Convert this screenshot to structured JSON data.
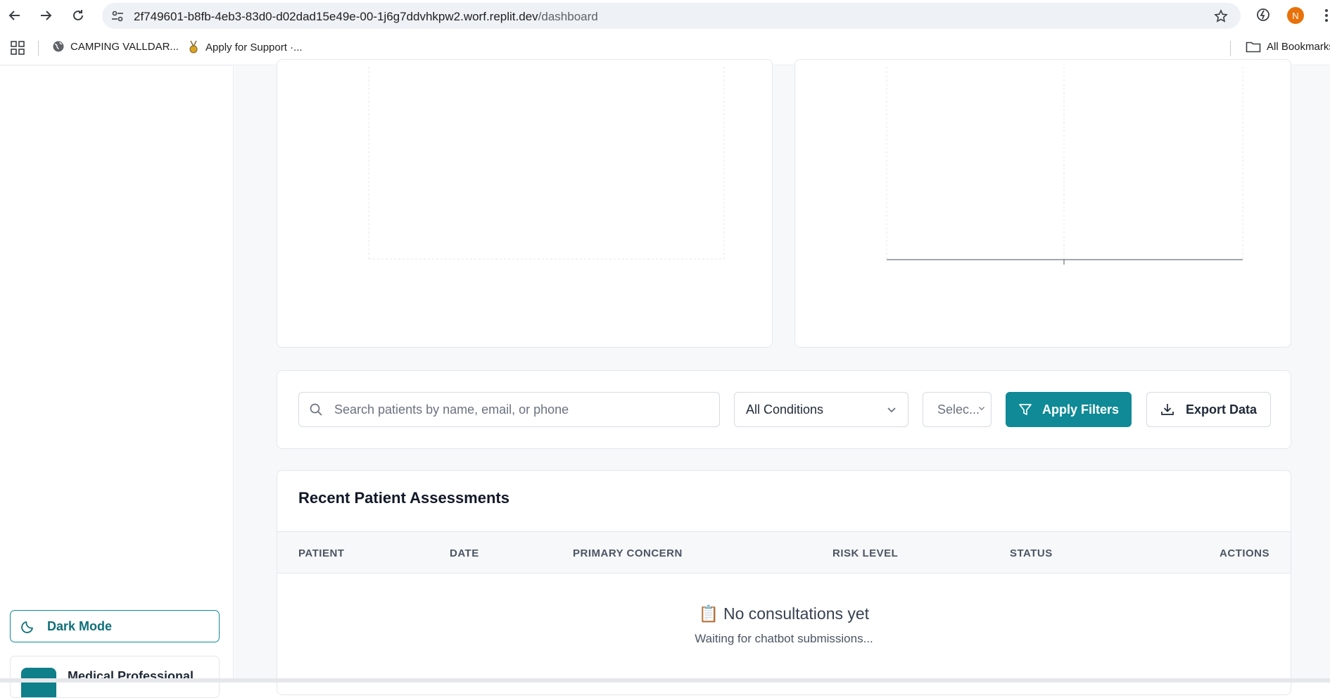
{
  "browser": {
    "url_host": "2f749601-b8fb-4eb3-83d0-d02dad15e49e-00-1j6g7ddvhkpw2.worf.replit.dev",
    "url_path": "/dashboard",
    "avatar_letter": "N",
    "bookmarks": [
      {
        "label": "CAMPING VALLDAR...",
        "icon": "globe-icon"
      },
      {
        "label": "Apply for Support  ·...",
        "icon": "award-icon"
      }
    ],
    "all_bookmarks_label": "All Bookmarks"
  },
  "sidebar": {
    "dark_mode_label": "Dark Mode",
    "profile_name": "Medical Professional"
  },
  "filters": {
    "search_placeholder": "Search patients by name, email, or phone",
    "condition_select": "All Conditions",
    "second_select": "Selec...",
    "apply_label": "Apply Filters",
    "export_label": "Export Data"
  },
  "table": {
    "title": "Recent Patient Assessments",
    "columns": [
      "PATIENT",
      "DATE",
      "PRIMARY CONCERN",
      "RISK LEVEL",
      "STATUS",
      "ACTIONS"
    ],
    "empty_title": "No consultations yet",
    "empty_icon": "📋",
    "empty_subtitle": "Waiting for chatbot submissions..."
  },
  "colors": {
    "accent": "#0f8a96",
    "background": "#f7f8fa"
  }
}
